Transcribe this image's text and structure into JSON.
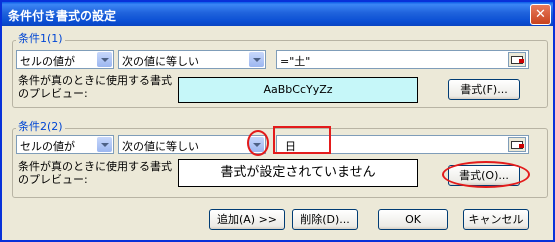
{
  "window": {
    "title": "条件付き書式の設定",
    "close_glyph": "✕"
  },
  "condition1": {
    "legend": "条件1(1)",
    "type_select": "セルの値が",
    "operator_select": "次の値に等しい",
    "value": "=\"土\"",
    "preview_label": "条件が真のときに使用する書式のプレビュー:",
    "preview_text": "AaBbCcYyZz",
    "preview_bg": "#c6f7f9",
    "format_button": "書式(F)..."
  },
  "condition2": {
    "legend": "条件2(2)",
    "type_select": "セルの値が",
    "operator_select": "次の値に等しい",
    "value": "日",
    "preview_label": "条件が真のときに使用する書式のプレビュー:",
    "preview_text": "書式が設定されていません",
    "preview_bg": "#ffffff",
    "format_button": "書式(O)..."
  },
  "footer": {
    "add_button": "追加(A) >>",
    "delete_button": "削除(D)...",
    "ok_button": "OK",
    "cancel_button": "キャンセル"
  },
  "colors": {
    "title_bar": "#0a5ce8",
    "accent_legend": "#0046d5",
    "annotation": "#e31b1b"
  }
}
